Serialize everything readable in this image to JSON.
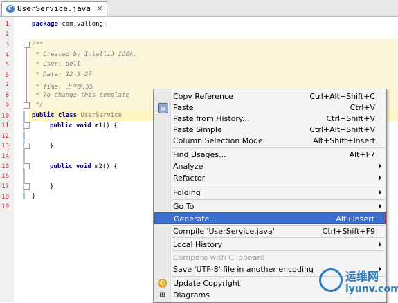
{
  "tab": {
    "icon": "C",
    "label": "UserService.java",
    "close": "×"
  },
  "line_numbers": [
    "1",
    "2",
    "3",
    "4",
    "5",
    "6",
    "7",
    "8",
    "9",
    "10",
    "11",
    "12",
    "13",
    "14",
    "15",
    "16",
    "17",
    "18",
    "19"
  ],
  "code": {
    "l1_kw": "package",
    "l1_rest": " com.vallong;",
    "l3": "/**",
    "l4": " * Created by IntelliJ IDEA.",
    "l5": " * User: dell",
    "l6": " * Date: 12-3-27",
    "l7": " * Time: 上午9:55",
    "l8": " * To change this template",
    "l9": " */",
    "l10_kw1": "public",
    "l10_kw2": "class",
    "l10_name": "UserService",
    "l11_kw1": "public",
    "l11_kw2": "void",
    "l11_rest": "m1() {",
    "l13": "}",
    "l15_kw1": "public",
    "l15_kw2": "void",
    "l15_rest": "m2() {",
    "l17": "}",
    "l18": "}"
  },
  "menu": {
    "items": [
      {
        "label": "Copy Reference",
        "shortcut": "Ctrl+Alt+Shift+C"
      },
      {
        "label": "Paste",
        "shortcut": "Ctrl+V",
        "icon": "paste-icon"
      },
      {
        "label": "Paste from History...",
        "shortcut": "Ctrl+Shift+V"
      },
      {
        "label": "Paste Simple",
        "shortcut": "Ctrl+Alt+Shift+V"
      },
      {
        "label": "Column Selection Mode",
        "shortcut": "Alt+Shift+Insert"
      },
      {
        "label": "Find Usages...",
        "shortcut": "Alt+F7"
      },
      {
        "label": "Analyze",
        "submenu": true
      },
      {
        "label": "Refactor",
        "submenu": true
      },
      {
        "label": "Folding",
        "submenu": true
      },
      {
        "label": "Go To",
        "submenu": true
      },
      {
        "label": "Generate...",
        "shortcut": "Alt+Insert",
        "selected": true
      },
      {
        "label": "Compile 'UserService.java'",
        "shortcut": "Ctrl+Shift+F9"
      },
      {
        "label": "Local History",
        "submenu": true
      },
      {
        "label": "Compare with Clipboard",
        "disabled": true
      },
      {
        "label": "Save 'UTF-8' file in another encoding",
        "submenu": true
      },
      {
        "label": "Update Copyright",
        "icon": "copyright-icon"
      },
      {
        "label": "Diagrams",
        "icon": "diagram-icon"
      }
    ]
  },
  "watermark": {
    "cn": "运维网",
    "en": "iyunv.com"
  },
  "colors": {
    "selection": "#3b6fcf",
    "selection_border": "#d21e1e",
    "keyword": "#000080",
    "comment": "#808080",
    "line_number": "#c02020"
  }
}
